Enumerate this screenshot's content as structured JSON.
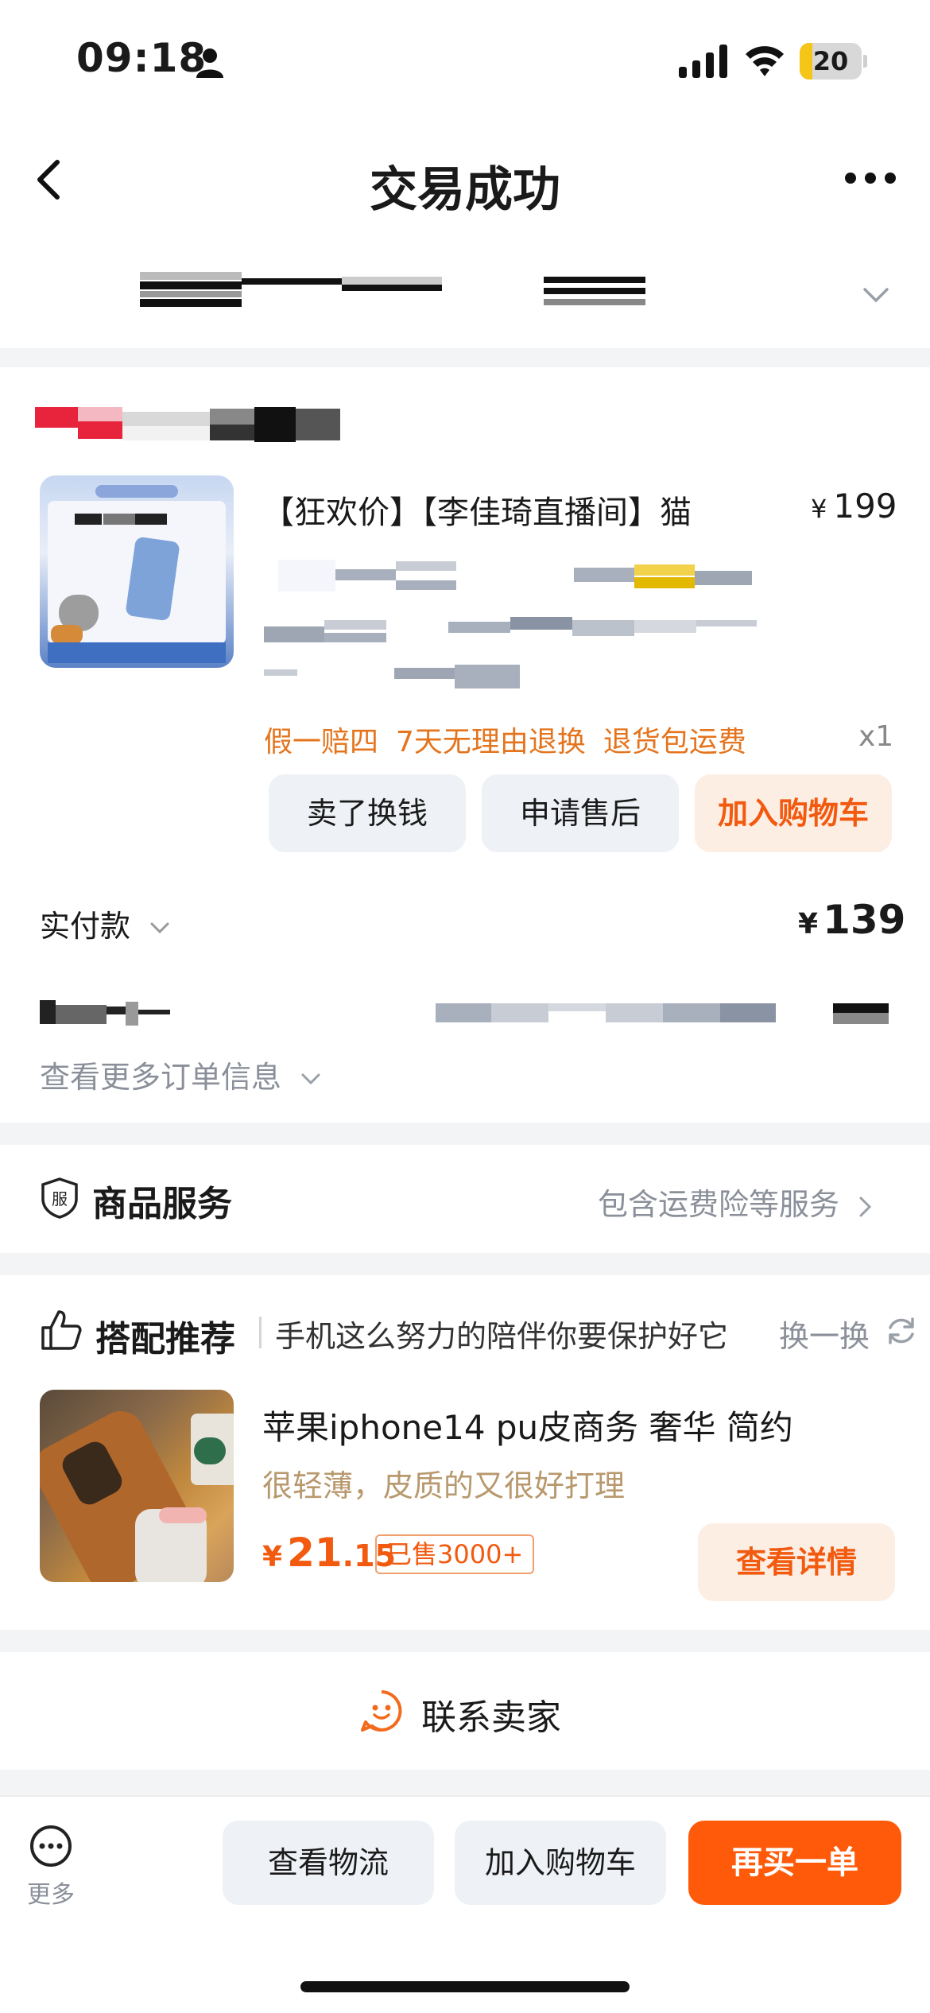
{
  "status_bar": {
    "time": "09:18",
    "battery_level": "20",
    "battery_fraction": 0.2
  },
  "nav": {
    "title": "交易成功"
  },
  "order": {
    "product_title": "【狂欢价】【李佳琦直播间】猫",
    "price_symbol": "¥",
    "price": "199",
    "badges": [
      "假一赔四",
      "7天无理由退换",
      "退货包运费"
    ],
    "quantity": "x1",
    "actions": {
      "sell": "卖了换钱",
      "after_sale": "申请售后",
      "add_cart": "加入购物车"
    },
    "paid_label": "实付款",
    "paid_symbol": "¥",
    "paid_amount": "139",
    "more_info": "查看更多订单信息"
  },
  "service": {
    "label": "商品服务",
    "detail": "包含运费险等服务"
  },
  "recommend": {
    "title": "搭配推荐",
    "subtitle": "手机这么努力的陪伴你要保护好它",
    "swap": "换一换",
    "item": {
      "name": "苹果iphone14 pu皮商务 奢华 简约",
      "desc": "很轻薄，皮质的又很好打理",
      "price_symbol": "¥",
      "price_int": "21",
      "price_dec": ".15",
      "sold": "已售3000+",
      "detail_button": "查看详情"
    }
  },
  "contact": {
    "label": "联系卖家"
  },
  "bottom_bar": {
    "more": "更多",
    "logistics": "查看物流",
    "add_cart": "加入购物车",
    "buy_again": "再买一单"
  },
  "colors": {
    "accent": "#ff5a0a",
    "badge_orange": "#e4741d",
    "muted": "#8a8f99"
  }
}
